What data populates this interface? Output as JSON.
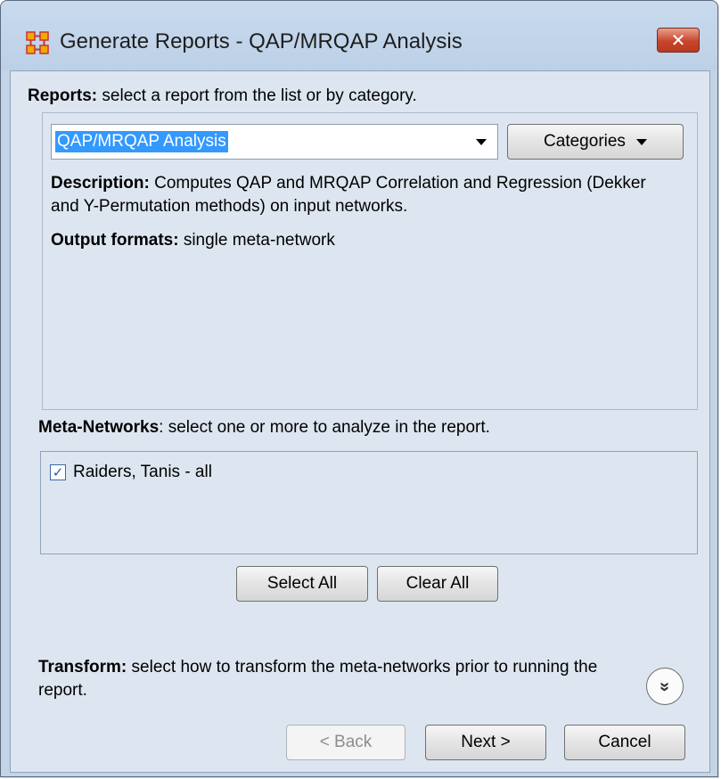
{
  "window": {
    "title": "Generate Reports - QAP/MRQAP Analysis",
    "close_label": "✕"
  },
  "reports": {
    "label_bold": "Reports:",
    "label_rest": " select a report from the list or by category.",
    "selected": "QAP/MRQAP Analysis",
    "categories_label": "Categories",
    "description_bold": "Description:",
    "description_text": " Computes QAP and MRQAP Correlation and Regression (Dekker and Y-Permutation methods) on input networks.",
    "output_bold": "Output formats:",
    "output_text": " single meta-network"
  },
  "meta_networks": {
    "label_bold": "Meta-Networks",
    "label_rest": ": select one or more to analyze in the report.",
    "items": [
      {
        "label": "Raiders, Tanis - all",
        "checked": true
      }
    ],
    "select_all": "Select All",
    "clear_all": "Clear All"
  },
  "transform": {
    "label_bold": "Transform:",
    "label_rest": " select how to transform the meta-networks prior to running the report.",
    "expand_glyph": "»"
  },
  "footer": {
    "back": "< Back",
    "next": "Next >",
    "cancel": "Cancel"
  },
  "colors": {
    "selection": "#3399ff",
    "close_button": "#c8452c",
    "client_bg": "#dde6f0"
  }
}
